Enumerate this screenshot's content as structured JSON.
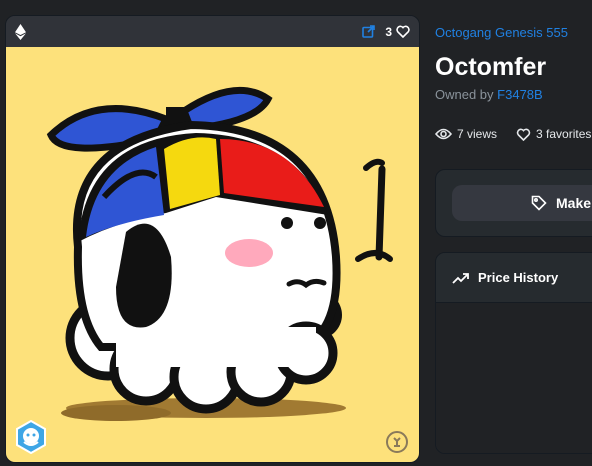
{
  "card": {
    "favorite_count": "3",
    "icons": [
      "ethereum-icon",
      "external-link-icon",
      "heart-icon"
    ],
    "art_background": "#fde17b"
  },
  "detail": {
    "collection": "Octogang Genesis 555",
    "title": "Octomfer",
    "owned_prefix": "Owned by",
    "owner": "F3478B",
    "views": "7 views",
    "favorites": "3 favorites",
    "make_offer_label": "Make",
    "price_history_label": "Price History"
  },
  "colors": {
    "accent_link": "#2081e2",
    "panel": "#262b2f",
    "background": "#202225"
  }
}
